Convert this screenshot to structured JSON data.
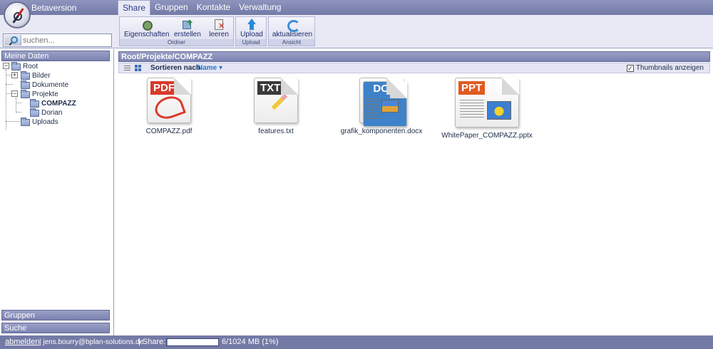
{
  "header": {
    "version_label": "Betaversion",
    "search_placeholder": "suchen..."
  },
  "tabs": [
    {
      "label": "Share",
      "active": true
    },
    {
      "label": "Gruppen"
    },
    {
      "label": "Kontakte"
    },
    {
      "label": "Verwaltung"
    }
  ],
  "ribbon": {
    "ordner": {
      "title": "Ordner",
      "buttons": [
        "Eigenschaften",
        "erstellen",
        "leeren"
      ]
    },
    "upload": {
      "title": "Upload",
      "buttons": [
        "Upload"
      ]
    },
    "ansicht": {
      "title": "Ansicht",
      "buttons": [
        "aktualisieren"
      ]
    }
  },
  "sidebar": {
    "sections": [
      "Meine Daten",
      "Gruppen",
      "Suche"
    ],
    "tree": [
      {
        "label": "Root"
      },
      {
        "label": "Bilder"
      },
      {
        "label": "Dokumente"
      },
      {
        "label": "Projekte"
      },
      {
        "label": "COMPAZZ",
        "selected": true
      },
      {
        "label": "Dorian"
      },
      {
        "label": "Uploads"
      }
    ]
  },
  "main": {
    "path": "Root/Projekte/COMPAZZ",
    "sort_label": "Sortieren nach:",
    "sort_value": "Name ▾",
    "thumbnails_label": "Thumbnails anzeigen",
    "thumbnails_checked": true,
    "files": [
      {
        "name": "COMPAZZ.pdf",
        "type": "PDF",
        "icon": "pdf-file-icon"
      },
      {
        "name": "features.txt",
        "type": "TXT",
        "icon": "txt-file-icon"
      },
      {
        "name": "grafik_komponenten.docx",
        "type": "DOC",
        "icon": "doc-file-icon"
      },
      {
        "name": "WhitePaper_COMPAZZ.pptx",
        "type": "PPT",
        "icon": "ppt-file-icon"
      }
    ]
  },
  "footer": {
    "logout": "abmelden",
    "email": "| jens.bourry@bplan-solutions.de",
    "share_label": "| Share:",
    "share_fraction": 0.01,
    "share_text": "6/1024 MB (1%)"
  },
  "colors": {
    "accent_bar": "#747aa6",
    "tab_active_text": "#2a3a8a",
    "link_blue": "#2f74c9"
  }
}
